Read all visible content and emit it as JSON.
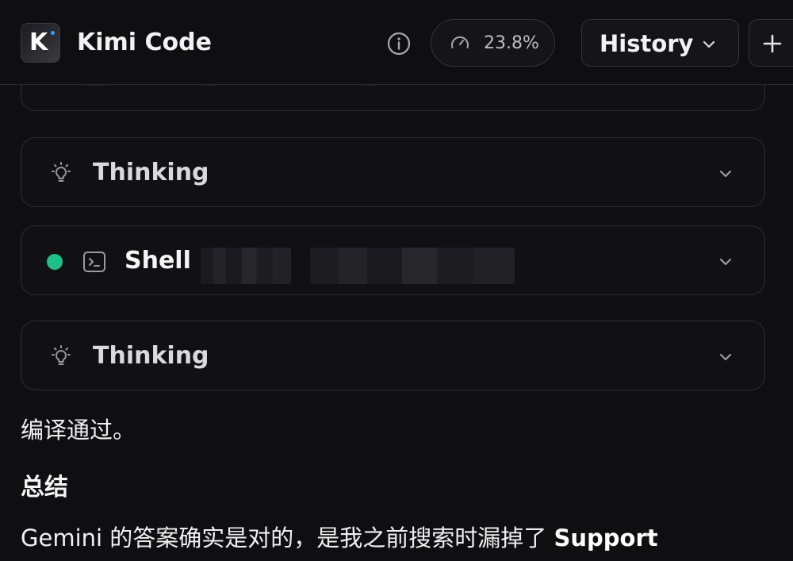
{
  "header": {
    "logo_letter": "K",
    "app_title": "Kimi Code",
    "usage_percent": "23.8%",
    "history_label": "History",
    "icons": {
      "info": "info-icon",
      "usage": "gauge-icon",
      "history_dropdown": "chevron-down-icon",
      "new": "plus-icon"
    }
  },
  "cards": [
    {
      "kind": "thinking",
      "label": "Thinking",
      "icon": "lightbulb-icon"
    },
    {
      "kind": "shell",
      "label": "Shell",
      "icon": "terminal-icon",
      "status_color": "#1fbf8a"
    },
    {
      "kind": "thinking",
      "label": "Thinking",
      "icon": "lightbulb-icon"
    }
  ],
  "content": {
    "para_1": "编译通过。",
    "heading": "总结",
    "para_2_text": "Gemini 的答案确实是对的，是我之前搜索时漏掉了 ",
    "para_2_bold": "Support"
  },
  "colors": {
    "background": "#0f0f11",
    "border": "#2e2e33",
    "accent_green": "#1fbf8a",
    "logo_dot": "#3b9bff"
  }
}
